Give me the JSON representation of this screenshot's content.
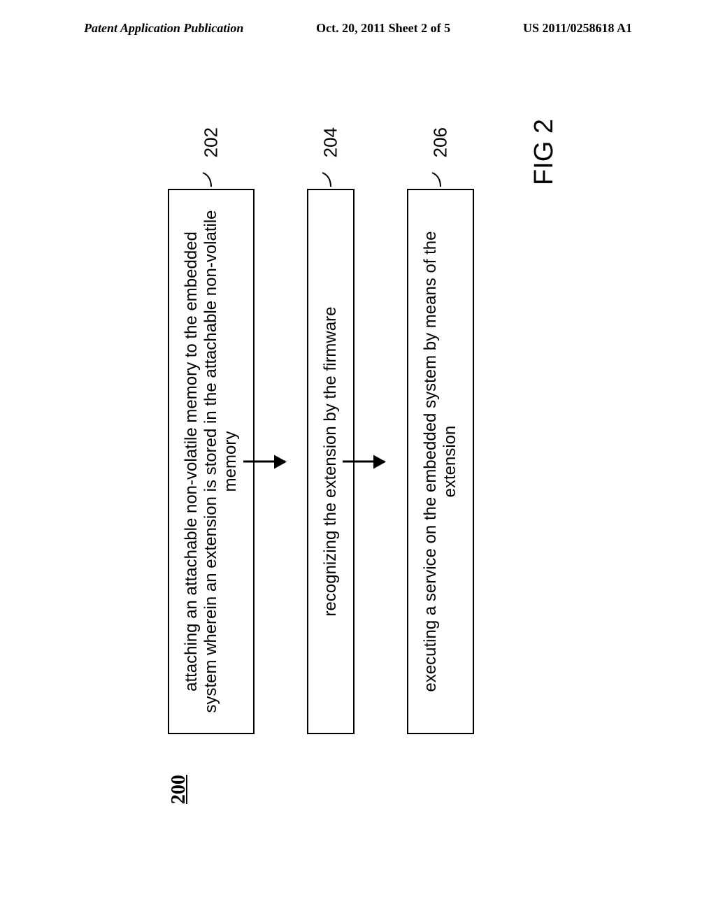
{
  "header": {
    "left": "Patent Application Publication",
    "center": "Oct. 20, 2011  Sheet 2 of 5",
    "right": "US 2011/0258618 A1"
  },
  "figure": {
    "number": "200",
    "label": "FIG 2",
    "steps": [
      {
        "text": "attaching an attachable non-volatile memory to the embedded system wherein an extension is stored in the attachable non-volatile memory",
        "ref": "202"
      },
      {
        "text": "recognizing the extension by the firmware",
        "ref": "204"
      },
      {
        "text": "executing a service on the embedded system by means of the extension",
        "ref": "206"
      }
    ]
  }
}
